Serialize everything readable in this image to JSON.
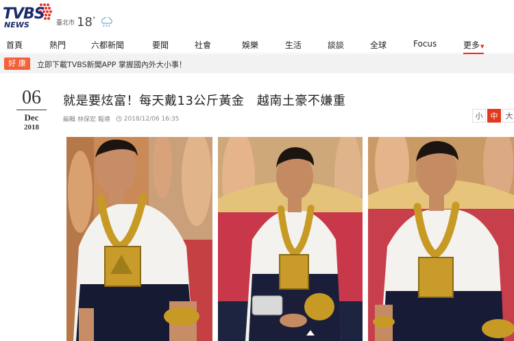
{
  "header": {
    "logo_text": "TVBS",
    "logo_sub": "NEWS",
    "weather_city": "臺北市",
    "weather_temp": "18",
    "weather_deg": "°",
    "weather_icon": "rain-cloud-icon"
  },
  "nav": {
    "items": [
      "首頁",
      "熱門",
      "六都新聞",
      "要聞",
      "社會",
      "娛樂",
      "生活",
      "談談",
      "全球",
      "Focus",
      "更多"
    ]
  },
  "ticker": {
    "tag": "好 康",
    "message": "立即下載TVBS新聞APP 掌握國內外大小事！"
  },
  "article": {
    "date_day": "06",
    "date_month": "Dec",
    "date_year": "2018",
    "title": "就是要炫富！每天戴13公斤黃金　越南土豪不嫌重",
    "byline": "編輯 林保宏 報導",
    "timestamp": "2018/12/06 16:35",
    "font_sizes": [
      "小",
      "中",
      "大"
    ],
    "font_size_selected": "中"
  },
  "colors": {
    "accent": "#e03a1e",
    "ticker_tag": "#f3603a",
    "logo_blue": "#1b2a6b"
  }
}
